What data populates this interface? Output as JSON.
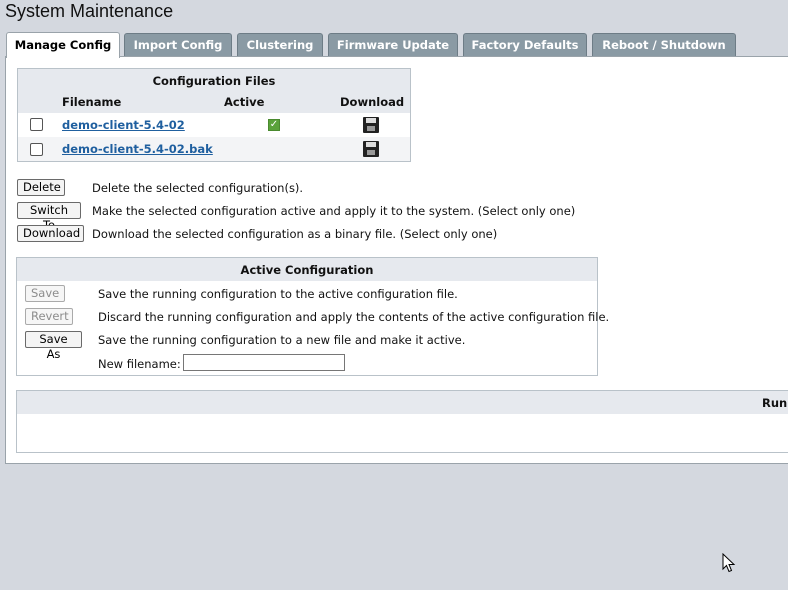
{
  "page": {
    "title": "System Maintenance"
  },
  "tabs": [
    {
      "label": "Manage Config",
      "active": true
    },
    {
      "label": "Import Config"
    },
    {
      "label": "Clustering"
    },
    {
      "label": "Firmware Update"
    },
    {
      "label": "Factory Defaults"
    },
    {
      "label": "Reboot / Shutdown"
    }
  ],
  "config_files": {
    "title": "Configuration Files",
    "columns": {
      "filename": "Filename",
      "active": "Active",
      "download": "Download"
    },
    "rows": [
      {
        "filename": "demo-client-5.4-02",
        "active": true
      },
      {
        "filename": "demo-client-5.4-02.bak",
        "active": false
      }
    ]
  },
  "actions": {
    "delete": {
      "label": "Delete",
      "desc": "Delete the selected configuration(s)."
    },
    "switch": {
      "label": "Switch To",
      "desc": "Make the selected configuration active and apply it to the system. (Select only one)"
    },
    "download": {
      "label": "Download",
      "desc": "Download the selected configuration as a binary file. (Select only one)"
    }
  },
  "active_config": {
    "title": "Active Configuration",
    "save": {
      "label": "Save",
      "desc": "Save the running configuration to the active configuration file."
    },
    "revert": {
      "label": "Revert",
      "desc": "Discard the running configuration and apply the contents of the active configuration file."
    },
    "save_as": {
      "label": "Save As",
      "desc": "Save the running configuration to a new file and make it active."
    },
    "new_filename_label": "New filename:",
    "new_filename_value": ""
  },
  "running_config": {
    "title_visible": "Run"
  }
}
